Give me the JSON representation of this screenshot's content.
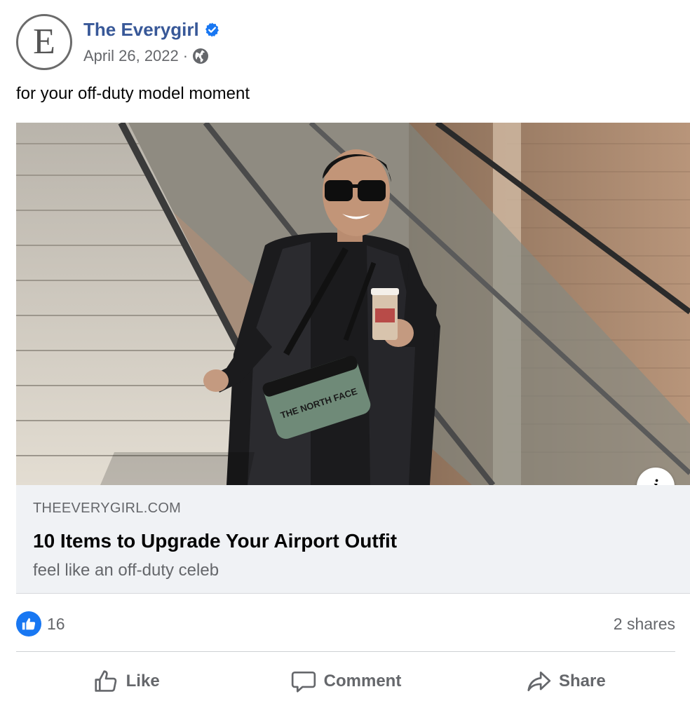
{
  "post": {
    "page_name": "The Everygirl",
    "avatar_letter": "E",
    "date": "April 26, 2022",
    "separator": "·",
    "caption": "for your off-duty model moment"
  },
  "link": {
    "domain": "THEEVERYGIRL.COM",
    "title": "10 Items to Upgrade Your Airport Outfit",
    "description": "feel like an off-duty celeb",
    "info_label": "i",
    "bag_logo": "THE NORTH FACE"
  },
  "reactions": {
    "like_count": "16",
    "shares": "2 shares"
  },
  "actions": {
    "like": "Like",
    "comment": "Comment",
    "share": "Share"
  },
  "colors": {
    "page_name": "#385898",
    "secondary_text": "#65676b",
    "like_blue": "#1877f2",
    "link_bg": "#f0f2f5"
  },
  "icons": {
    "verified": "verified-badge-icon",
    "audience": "globe-icon",
    "info": "info-icon",
    "like_reaction": "thumbs-up-icon",
    "like_action": "thumbs-up-outline-icon",
    "comment_action": "speech-bubble-icon",
    "share_action": "share-arrow-icon"
  }
}
